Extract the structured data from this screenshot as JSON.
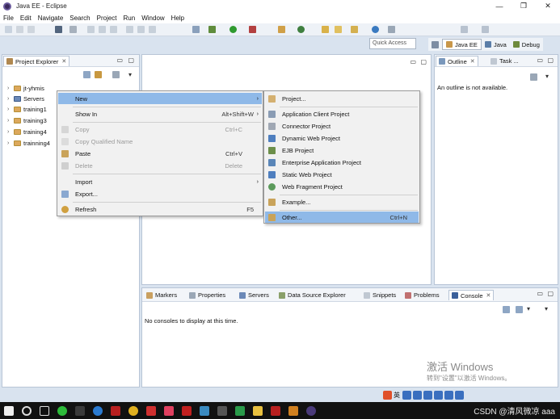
{
  "window": {
    "title": "Java EE - Eclipse",
    "controls": [
      "—",
      "❐",
      "✕"
    ]
  },
  "menubar": [
    "File",
    "Edit",
    "Navigate",
    "Search",
    "Project",
    "Run",
    "Window",
    "Help"
  ],
  "toolbar": {
    "quick_access_placeholder": "Quick Access"
  },
  "perspectives": [
    {
      "label": "Java EE",
      "active": true
    },
    {
      "label": "Java",
      "active": false
    },
    {
      "label": "Debug",
      "active": false
    }
  ],
  "project_explorer": {
    "tab_label": "Project Explorer",
    "items": [
      {
        "label": "jt-yhmis",
        "icon": "project-icon"
      },
      {
        "label": "Servers",
        "icon": "servers-folder-icon"
      },
      {
        "label": "training1",
        "icon": "project-icon"
      },
      {
        "label": "training3",
        "icon": "project-icon"
      },
      {
        "label": "training4",
        "icon": "project-icon"
      },
      {
        "label": "trainning4",
        "icon": "project-icon"
      }
    ]
  },
  "outline": {
    "tab_label": "Outline",
    "task_tab_label": "Task ...",
    "message": "An outline is not available."
  },
  "context_menu": {
    "items": [
      {
        "label": "New",
        "shortcut": "",
        "submenu": true,
        "disabled": false,
        "highlight": true
      },
      {
        "label": "Show In",
        "shortcut": "Alt+Shift+W",
        "submenu": true,
        "disabled": false
      },
      {
        "label": "Copy",
        "shortcut": "Ctrl+C",
        "disabled": true
      },
      {
        "label": "Copy Qualified Name",
        "shortcut": "",
        "disabled": true
      },
      {
        "label": "Paste",
        "shortcut": "Ctrl+V",
        "disabled": false
      },
      {
        "label": "Delete",
        "shortcut": "Delete",
        "disabled": true
      },
      {
        "label": "Import",
        "shortcut": "",
        "submenu": true,
        "disabled": false
      },
      {
        "label": "Export...",
        "shortcut": "",
        "disabled": false
      },
      {
        "label": "Refresh",
        "shortcut": "F5",
        "disabled": false
      }
    ]
  },
  "new_submenu": {
    "items": [
      {
        "label": "Project..."
      },
      {
        "label": "Application Client Project"
      },
      {
        "label": "Connector Project"
      },
      {
        "label": "Dynamic Web Project"
      },
      {
        "label": "EJB Project"
      },
      {
        "label": "Enterprise Application Project"
      },
      {
        "label": "Static Web Project"
      },
      {
        "label": "Web Fragment Project"
      },
      {
        "label": "Example..."
      },
      {
        "label": "Other...",
        "shortcut": "Ctrl+N",
        "highlight": true
      }
    ]
  },
  "bottom_panel": {
    "tabs": [
      "Markers",
      "Properties",
      "Servers",
      "Data Source Explorer",
      "Snippets",
      "Problems",
      "Console"
    ],
    "active_tab": "Console",
    "message": "No consoles to display at this time."
  },
  "watermark": {
    "line1": "激活 Windows",
    "line2": "转到\"设置\"以激活 Windows。"
  },
  "taskbar": {
    "corner_text": "CSDN @清风微凉 aaa",
    "ime_label": "英"
  },
  "colors": {
    "highlight": "#8fb9e8",
    "taskbar": "#111111",
    "workbench_bg": "#d9e3ef"
  }
}
